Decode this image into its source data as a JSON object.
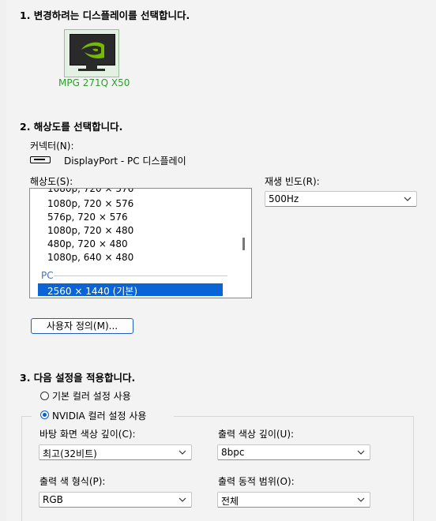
{
  "section1": {
    "title": "1. 변경하려는 디스플레이를 선택합니다."
  },
  "display": {
    "name": "MPG 271Q X50",
    "icon": "monitor-icon"
  },
  "section2": {
    "title": "2. 해상도를 선택합니다.",
    "connector_label": "커넥터(N):",
    "connector_value": "DisplayPort - PC 디스플레이",
    "resolution_label": "해상도(S):",
    "refresh_label": "재생 빈도(R):",
    "refresh_value": "500Hz",
    "resolutions": [
      "1080p, 720 × 576",
      "576p, 720 × 576",
      "1080p, 720 × 480",
      "480p, 720 × 480",
      "1080p, 640 × 480"
    ],
    "group_pc": "PC",
    "selected_resolution": "2560 × 1440 (기본)",
    "custom_button": "사용자 정의(M)..."
  },
  "section3": {
    "title": "3. 다음 설정을 적용합니다.",
    "radio_default": "기본 컬러 설정 사용",
    "radio_nvidia": "NVIDIA 컬러 설정 사용",
    "desktop_depth_label": "바탕 화면 색상 깊이(C):",
    "desktop_depth_value": "최고(32비트)",
    "output_depth_label": "출력 색상 깊이(U):",
    "output_depth_value": "8bpc",
    "output_format_label": "출력 색 형식(P):",
    "output_format_value": "RGB",
    "dynamic_range_label": "출력 동적 범위(O):",
    "dynamic_range_value": "전체"
  },
  "colors": {
    "accent": "#0a64d6",
    "display_name": "#2e9d2e",
    "group_header": "#4a6fb0"
  }
}
